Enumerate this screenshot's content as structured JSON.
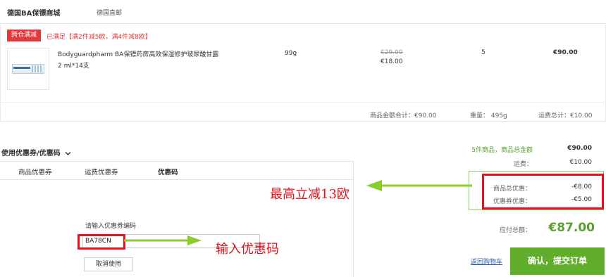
{
  "store": {
    "name": "德国BA保镖商城",
    "sub": "德国直邮"
  },
  "promo": {
    "tag": "跨仓满减",
    "text": "已满足【满2件减5欧，满4件减8欧】"
  },
  "item": {
    "title": "Bodyguardpharm BA保镖药房高效保湿修护玻尿酸甘露 2 ml*14支",
    "weight": "99g",
    "price_old": "€29.00",
    "price_new": "€18.00",
    "qty": "5",
    "subtotal": "€90.00"
  },
  "order_summary": {
    "goods_total": "商品金额合计：€90.00",
    "weight": "重量：  495g",
    "shipping_total": "运费总计：€10.00"
  },
  "coupon": {
    "toggle": "使用优惠券/优惠码",
    "tabs": [
      "商品优惠券",
      "运费优惠券",
      "优惠码"
    ],
    "code_label": "请输入优惠券编码",
    "code_value": "BA78CN",
    "cancel": "取消使用"
  },
  "annotations": {
    "max_discount": "最高立减13欧",
    "enter_code": "输入优惠码"
  },
  "totals": {
    "items_label": "5件商品，商品总金额",
    "items_value": "€90.00",
    "shipping_label": "运费：",
    "shipping_value": "€10.00",
    "goods_discount_label": "商品总优惠：",
    "goods_discount_value": "-€8.00",
    "coupon_discount_label": "优惠券优惠：",
    "coupon_discount_value": "-€5.00",
    "payable_label": "应付总额：",
    "payable_value": "€87.00"
  },
  "actions": {
    "back": "返回购物车",
    "submit": "确认，提交订单"
  },
  "colors": {
    "accent_green": "#60ae2b",
    "promo_red": "#e4393c",
    "annotation_red": "#e0141e"
  },
  "icons": {
    "toggle": "chevron-down-icon",
    "arrow": "arrow-left-icon",
    "arrow2": "arrow-right-icon"
  }
}
